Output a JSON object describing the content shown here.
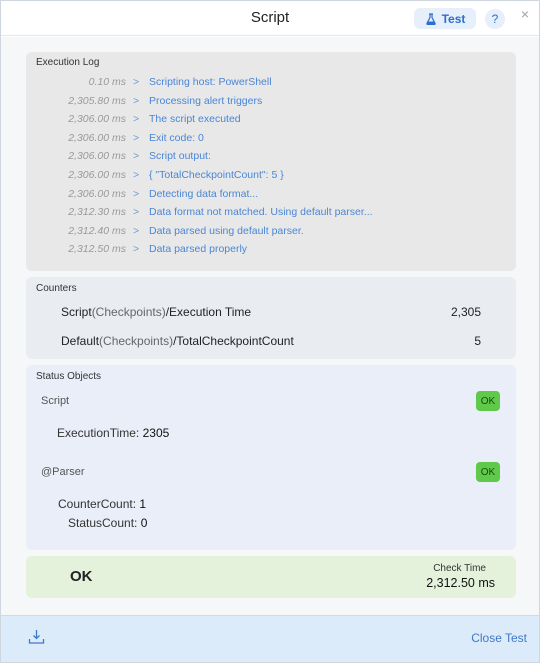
{
  "window": {
    "title": "Script"
  },
  "header": {
    "test_label": "Test",
    "help_label": "?",
    "close_label": "×"
  },
  "log": {
    "title": "Execution Log",
    "arrow": ">",
    "entries": [
      {
        "time": "0.10 ms",
        "message": "Scripting host: PowerShell"
      },
      {
        "time": "2,305.80 ms",
        "message": "Processing alert triggers"
      },
      {
        "time": "2,306.00 ms",
        "message": "The script executed"
      },
      {
        "time": "2,306.00 ms",
        "message": "Exit code: 0"
      },
      {
        "time": "2,306.00 ms",
        "message": "Script output:"
      },
      {
        "time": "2,306.00 ms",
        "message": "{ \"TotalCheckpointCount\": 5 }"
      },
      {
        "time": "2,306.00 ms",
        "message": "Detecting data format..."
      },
      {
        "time": "2,312.30 ms",
        "message": "Data format not matched. Using default parser..."
      },
      {
        "time": "2,312.40 ms",
        "message": "Data parsed using default parser."
      },
      {
        "time": "2,312.50 ms",
        "message": "Data parsed properly"
      }
    ]
  },
  "counters": {
    "title": "Counters",
    "rows": [
      {
        "prefix": "Script",
        "paren": "(Checkpoints)",
        "suffix": "/Execution Time",
        "value": "2,305"
      },
      {
        "prefix": "Default",
        "paren": "(Checkpoints)",
        "suffix": "/TotalCheckpointCount",
        "value": "5"
      }
    ]
  },
  "status_objects": {
    "title": "Status Objects",
    "objects": [
      {
        "name": "Script",
        "status": "OK",
        "props": [
          {
            "key": "ExecutionTime",
            "sep": ":",
            "value": "2305"
          }
        ]
      },
      {
        "name": "@Parser",
        "status": "OK",
        "props": [
          {
            "key": "CounterCount",
            "sep": ":",
            "value": "1"
          },
          {
            "key": "StatusCount",
            "sep": ":",
            "value": "0"
          }
        ]
      }
    ]
  },
  "result": {
    "status": "OK",
    "check_time_label": "Check Time",
    "check_time_value": "2,312.50 ms"
  },
  "footer": {
    "close_label": "Close Test"
  },
  "colors": {
    "accent": "#2c6fd1",
    "ok_green": "#5fc94a",
    "result_bg": "#e4f2dc",
    "footer_bg": "#dcebf9",
    "log_link": "#4a86d6"
  },
  "icons": {
    "test": "flask-icon",
    "help": "question-icon",
    "close": "close-icon",
    "download": "download-icon"
  }
}
